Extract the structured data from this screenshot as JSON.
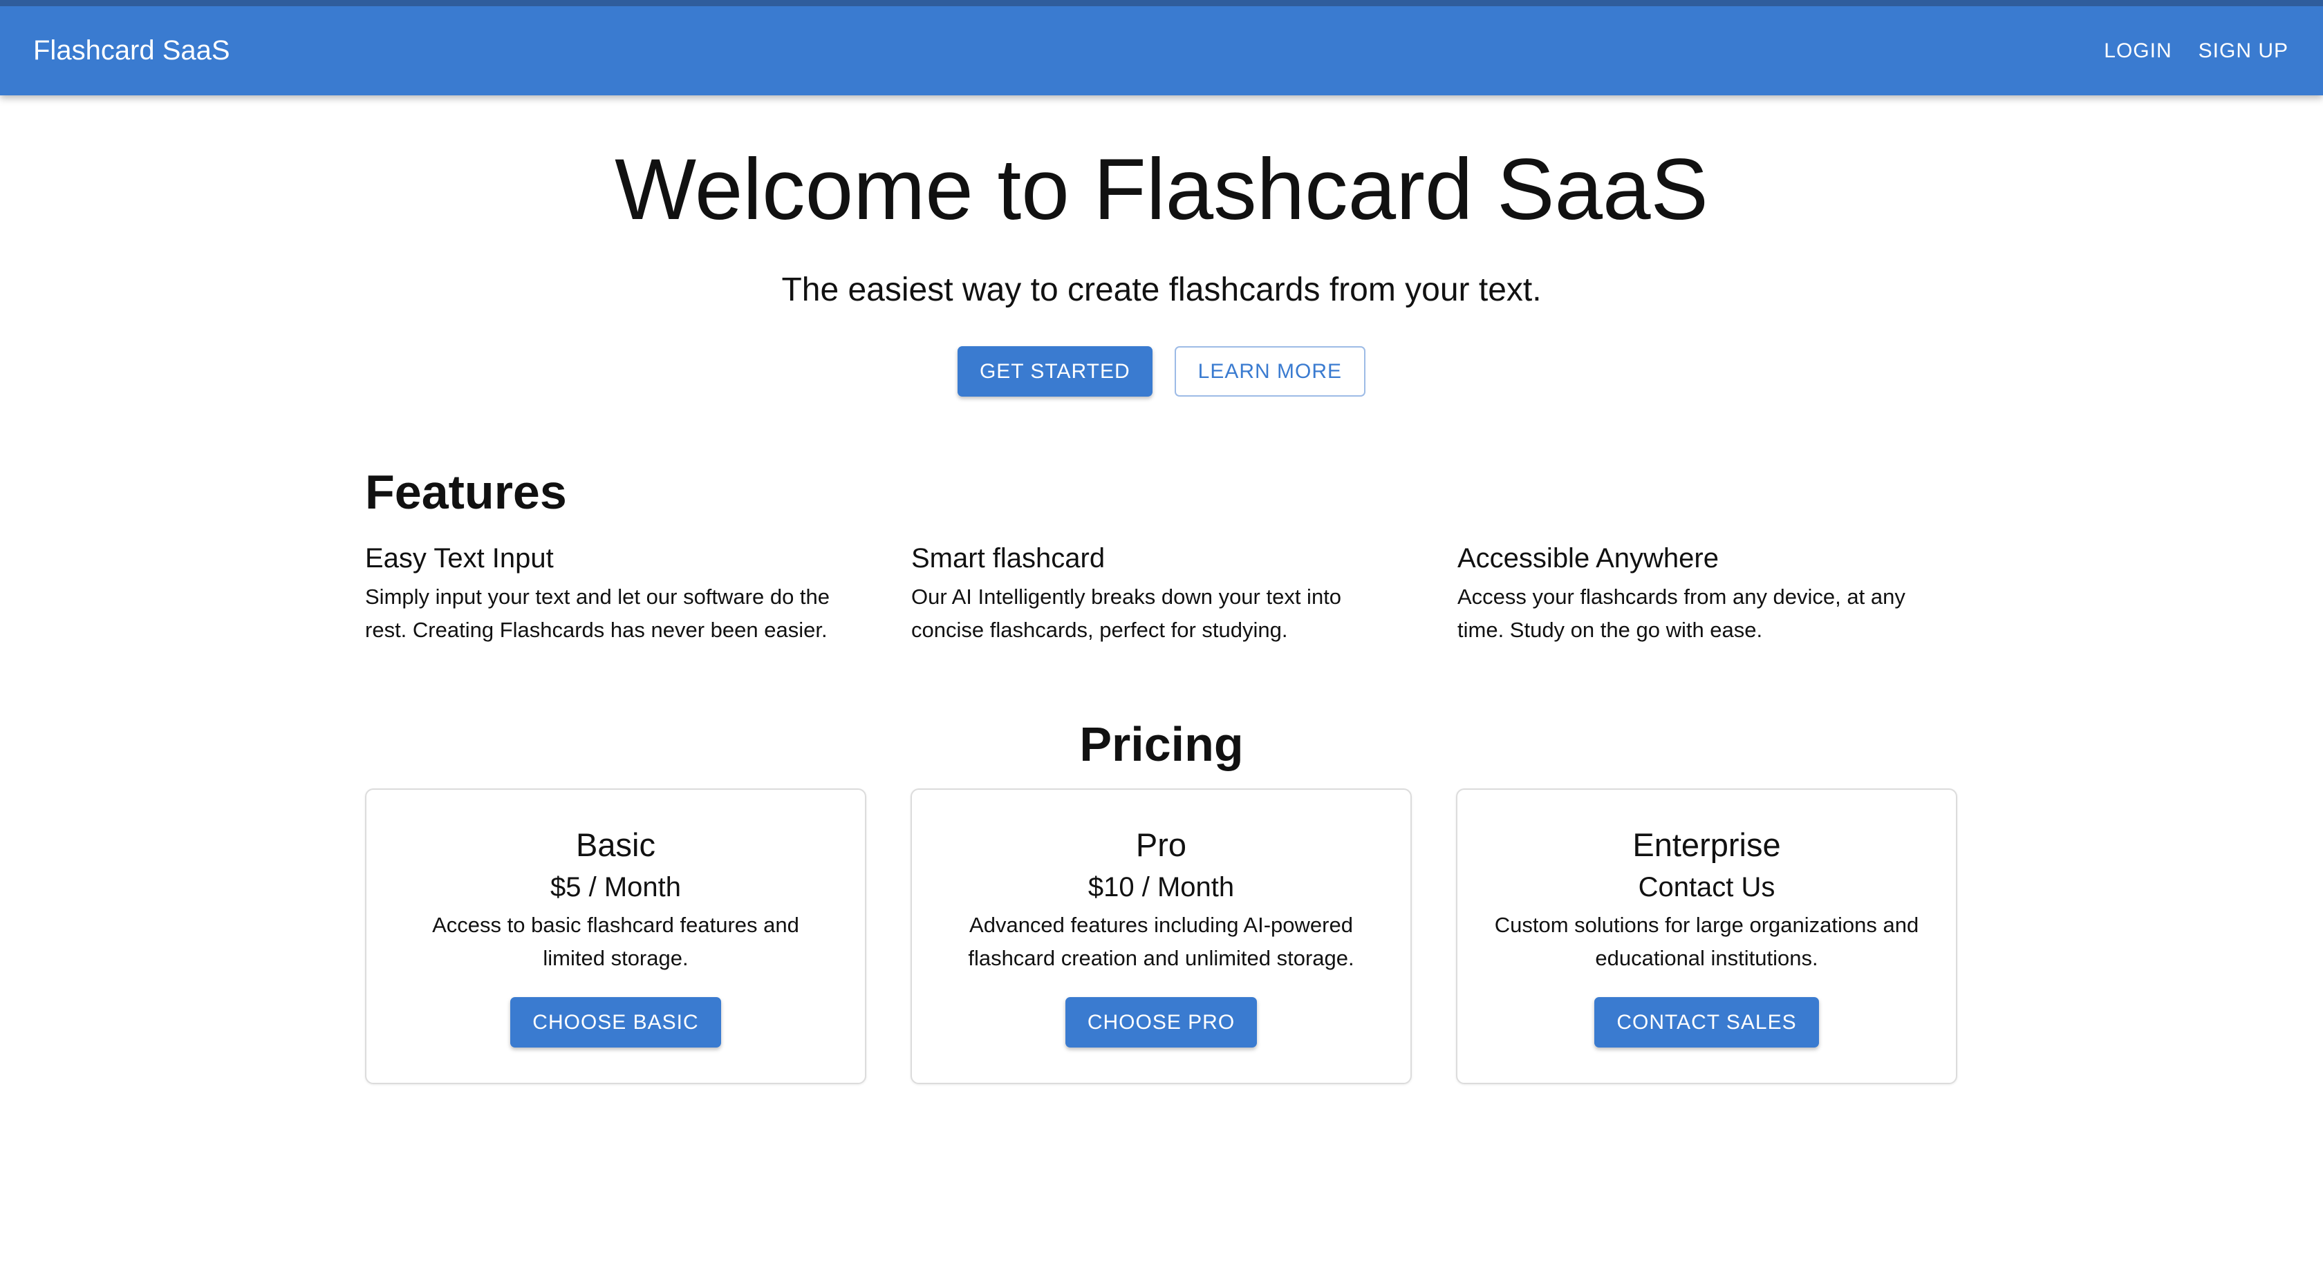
{
  "appbar": {
    "brand": "Flashcard SaaS",
    "login_label": "LOGIN",
    "signup_label": "SIGN UP"
  },
  "hero": {
    "title": "Welcome to Flashcard SaaS",
    "subtitle": "The easiest way to create flashcards from your text.",
    "get_started_label": "GET STARTED",
    "learn_more_label": "LEARN MORE"
  },
  "features": {
    "title": "Features",
    "items": [
      {
        "title": "Easy Text Input",
        "description": "Simply input your text and let our software do the rest. Creating Flashcards has never been easier."
      },
      {
        "title": "Smart flashcard",
        "description": "Our AI Intelligently breaks down your text into concise flashcards, perfect for studying."
      },
      {
        "title": "Accessible Anywhere",
        "description": "Access your flashcards from any device, at any time. Study on the go with ease."
      }
    ]
  },
  "pricing": {
    "title": "Pricing",
    "plans": [
      {
        "name": "Basic",
        "price": "$5 / Month",
        "description": "Access to basic flashcard features and limited storage.",
        "button_label": "CHOOSE BASIC"
      },
      {
        "name": "Pro",
        "price": "$10 / Month",
        "description": "Advanced features including AI-powered flashcard creation and unlimited storage.",
        "button_label": "CHOOSE PRO"
      },
      {
        "name": "Enterprise",
        "price": "Contact Us",
        "description": "Custom solutions for large organizations and educational institutions.",
        "button_label": "CONTACT SALES"
      }
    ]
  },
  "colors": {
    "primary": "#3a7bd0",
    "appbar_top_border": "#2f5d9c",
    "text": "#111111",
    "card_border": "#dcdcdc"
  }
}
